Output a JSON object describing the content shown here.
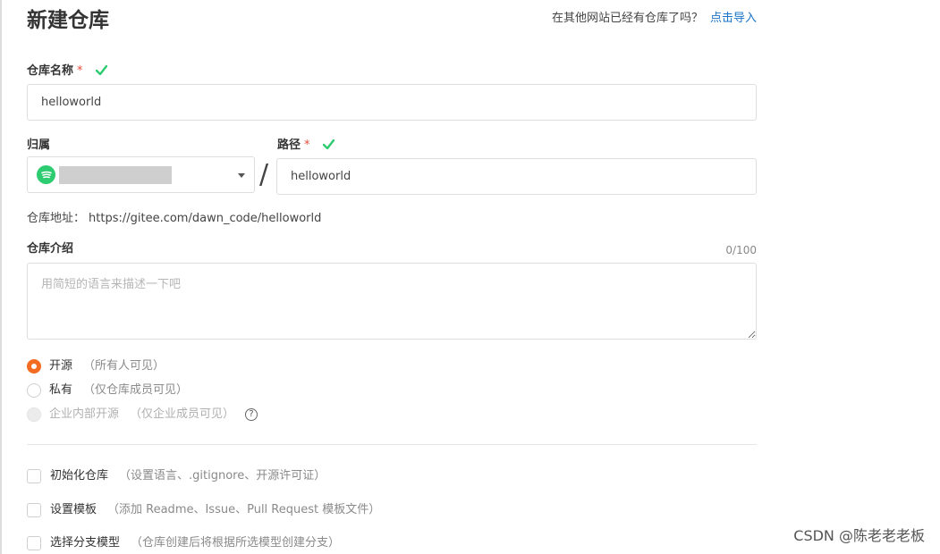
{
  "page": {
    "title": "新建仓库",
    "import_prompt": "在其他网站已经有仓库了吗？",
    "import_link": "点击导入"
  },
  "form": {
    "repo_name": {
      "label": "仓库名称",
      "required_mark": "*",
      "value": "helloworld"
    },
    "owner": {
      "label": "归属"
    },
    "separator": "/",
    "path": {
      "label": "路径",
      "required_mark": "*",
      "value": "helloworld"
    },
    "repo_url": {
      "label": "仓库地址：",
      "value": "https://gitee.com/dawn_code/helloworld"
    },
    "description": {
      "label": "仓库介绍",
      "counter": "0/100",
      "placeholder": "用简短的语言来描述一下吧"
    },
    "visibility": [
      {
        "label": "开源",
        "hint": "（所有人可见）",
        "selected": true,
        "disabled": false
      },
      {
        "label": "私有",
        "hint": "（仅仓库成员可见）",
        "selected": false,
        "disabled": false
      },
      {
        "label": "企业内部开源",
        "hint": "（仅企业成员可见）",
        "selected": false,
        "disabled": true
      }
    ],
    "help_glyph": "?",
    "options": [
      {
        "label": "初始化仓库",
        "hint": "（设置语言、.gitignore、开源许可证）",
        "checked": false
      },
      {
        "label": "设置模板",
        "hint": "（添加 Readme、Issue、Pull Request 模板文件）",
        "checked": false
      },
      {
        "label": "选择分支模型",
        "hint": "（仓库创建后将根据所选模型创建分支）",
        "checked": false
      }
    ]
  },
  "watermark": "CSDN @陈老老老板",
  "colors": {
    "accent": "#f36c21",
    "link": "#1a73c6",
    "required": "#e74c3c",
    "valid_check": "#2ecc71"
  },
  "icons": {
    "valid": "check-icon",
    "owner_avatar": "avatar-icon",
    "dropdown": "caret-down-icon",
    "help": "question-circle-icon"
  }
}
